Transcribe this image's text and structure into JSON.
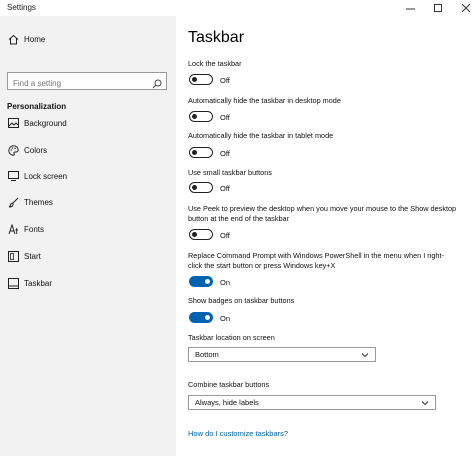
{
  "window": {
    "title": "Settings",
    "minimize_glyph": "—",
    "maximize_glyph": "☐",
    "close_glyph": "✕"
  },
  "sidebar": {
    "home_label": "Home",
    "search_placeholder": "Find a setting",
    "section_heading": "Personalization",
    "items": [
      {
        "label": "Background",
        "icon": "picture-icon"
      },
      {
        "label": "Colors",
        "icon": "palette-icon"
      },
      {
        "label": "Lock screen",
        "icon": "lock-screen-icon"
      },
      {
        "label": "Themes",
        "icon": "brush-icon"
      },
      {
        "label": "Fonts",
        "icon": "font-icon"
      },
      {
        "label": "Start",
        "icon": "start-icon"
      },
      {
        "label": "Taskbar",
        "icon": "taskbar-icon"
      }
    ],
    "selected": "Taskbar"
  },
  "main": {
    "title": "Taskbar",
    "settings": [
      {
        "label": "Lock the taskbar",
        "state": "Off",
        "on": false
      },
      {
        "label": "Automatically hide the taskbar in desktop mode",
        "state": "Off",
        "on": false
      },
      {
        "label": "Automatically hide the taskbar in tablet mode",
        "state": "Off",
        "on": false
      },
      {
        "label": "Use small taskbar buttons",
        "state": "Off",
        "on": false
      },
      {
        "label": "Use Peek to preview the desktop when you move your mouse to the Show desktop button at the end of the taskbar",
        "state": "Off",
        "on": false
      },
      {
        "label": "Replace Command Prompt with Windows PowerShell in the menu when I right-click the start button or press Windows key+X",
        "state": "On",
        "on": true
      },
      {
        "label": "Show badges on taskbar buttons",
        "state": "On",
        "on": true
      }
    ],
    "location": {
      "label": "Taskbar location on screen",
      "value": "Bottom"
    },
    "combine": {
      "label": "Combine taskbar buttons",
      "value": "Always, hide labels"
    },
    "help_link": "How do I customize taskbars?"
  },
  "colors": {
    "accent": "#0063b1",
    "sidebar_bg": "#f2f2f2"
  }
}
